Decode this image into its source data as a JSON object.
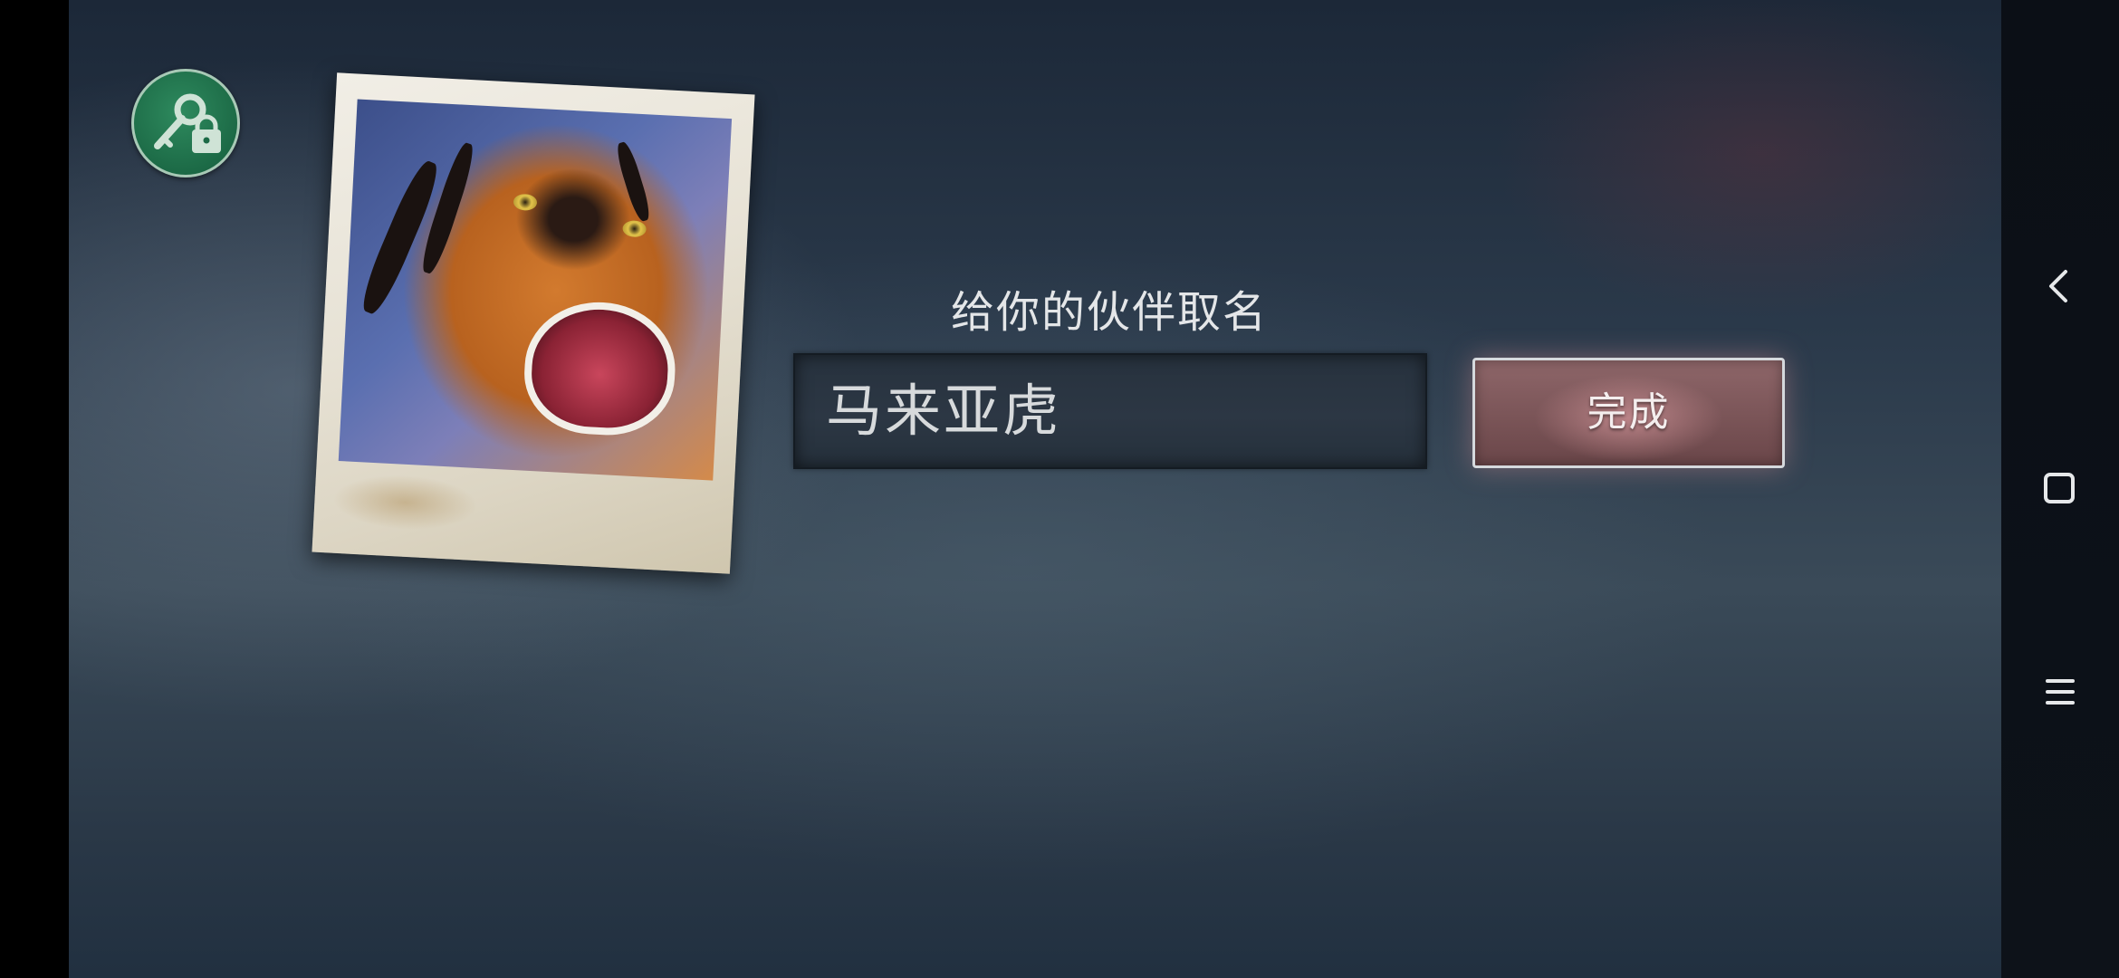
{
  "naming": {
    "title": "给你的伙伴取名",
    "name_value": "马来亚虎",
    "done_label": "完成"
  },
  "icons": {
    "key_button": "key-lock-icon",
    "companion_photo": "tiger-photo",
    "back": "back-icon",
    "home": "home-icon",
    "menu": "menu-icon"
  },
  "colors": {
    "key_button_green": "#1c6a46",
    "done_button": "#7c5659",
    "background": "#2b3a4b"
  }
}
